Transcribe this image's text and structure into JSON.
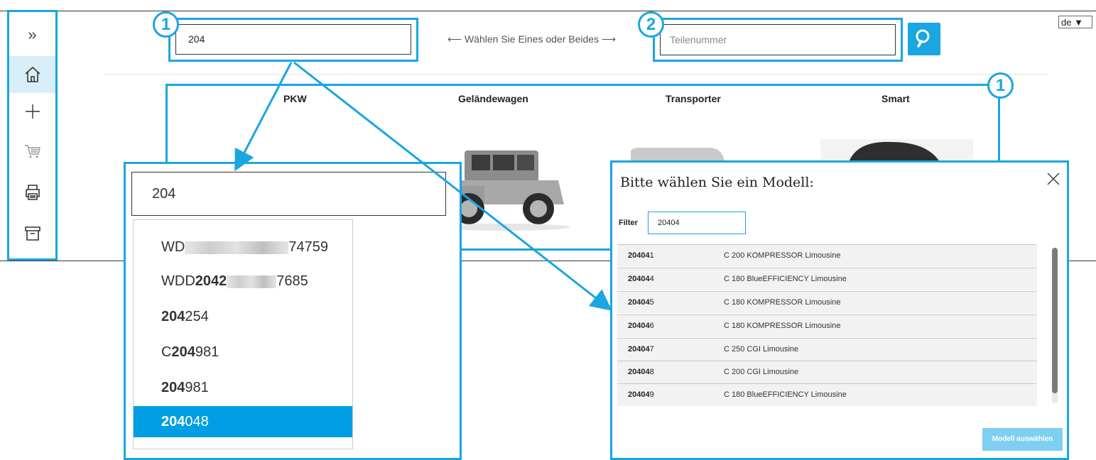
{
  "sidebar": {
    "items": [
      {
        "icon": "double-chevron-right-icon",
        "label": "»"
      },
      {
        "icon": "home-icon",
        "active": true
      },
      {
        "icon": "plus-icon"
      },
      {
        "icon": "cart-icon"
      },
      {
        "icon": "printer-icon"
      },
      {
        "icon": "archive-icon"
      }
    ]
  },
  "language": {
    "value": "de ▼"
  },
  "search": {
    "vehicle_value": "204",
    "hint": "⟵ Wählen Sie Eines oder Beides ⟶",
    "part_placeholder": "Teilenummer",
    "search_icon": "magnifier-icon"
  },
  "badges": {
    "one": "1",
    "two": "2"
  },
  "categories": [
    {
      "label": "PKW"
    },
    {
      "label": "Geländewagen"
    },
    {
      "label": "Transporter"
    },
    {
      "label": "Smart"
    }
  ],
  "dropdown": {
    "input_value": "204",
    "items": [
      {
        "pre": "WD",
        "bold": "",
        "post": "74759",
        "blurred": true
      },
      {
        "pre": "WDD",
        "bold": "2042",
        "post": "7685",
        "blurred": true
      },
      {
        "pre": "",
        "bold": "204",
        "post": "254"
      },
      {
        "pre": "C",
        "bold": "204",
        "post": "981"
      },
      {
        "pre": "",
        "bold": "204",
        "post": "981"
      },
      {
        "pre": "",
        "bold": "204",
        "post": "048",
        "selected": true
      }
    ]
  },
  "modal": {
    "title": "Bitte wählen Sie ein Modell:",
    "filter_label": "Filter",
    "filter_value": "20404",
    "rows": [
      {
        "code_bold": "20404",
        "code_rest": "1",
        "name": "C 200 KOMPRESSOR Limousine"
      },
      {
        "code_bold": "20404",
        "code_rest": "4",
        "name": "C 180 BlueEFFICIENCY Limousine"
      },
      {
        "code_bold": "20404",
        "code_rest": "5",
        "name": "C 180 KOMPRESSOR Limousine"
      },
      {
        "code_bold": "20404",
        "code_rest": "6",
        "name": "C 180 KOMPRESSOR Limousine"
      },
      {
        "code_bold": "20404",
        "code_rest": "7",
        "name": "C 250 CGI Limousine"
      },
      {
        "code_bold": "20404",
        "code_rest": "8",
        "name": "C 200 CGI Limousine"
      },
      {
        "code_bold": "20404",
        "code_rest": "9",
        "name": "C 180 BlueEFFICIENCY Limousine"
      }
    ],
    "select_button": "Modell auswählen"
  },
  "colors": {
    "accent": "#1aa6e0",
    "selected": "#009fe3",
    "button_disabled": "#7fcff0"
  }
}
